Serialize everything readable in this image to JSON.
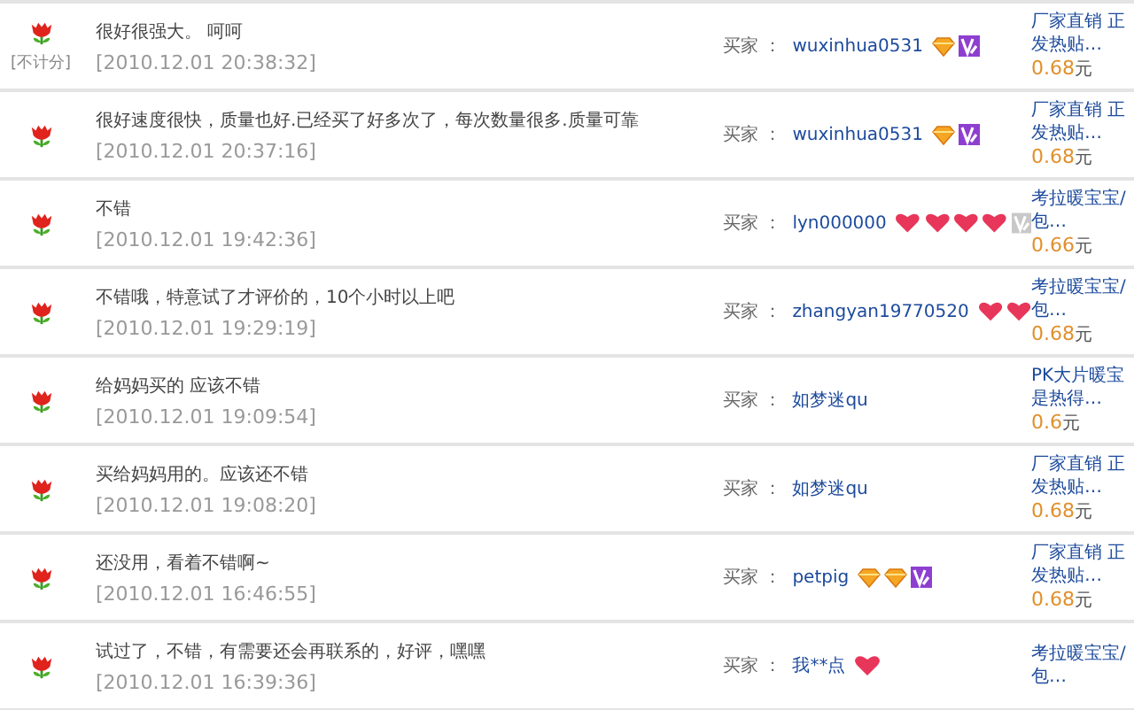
{
  "reviews": [
    {
      "rating": true,
      "note": "[不计分]",
      "comment": "很好很强大。 呵呵",
      "date": "[2010.12.01 20:38:32]",
      "buyer_label": "买家 ：",
      "buyer": "wuxinhua0531",
      "rank_icons": [
        {
          "kind": "diamond"
        }
      ],
      "vip_badge": {
        "active": true
      },
      "product": {
        "line1": "厂家直销 正",
        "line2": "发热贴…",
        "price": "0.68",
        "unit": "元"
      }
    },
    {
      "rating": true,
      "comment": "很好速度很快，质量也好.已经买了好多次了，每次数量很多.质量可靠",
      "date": "[2010.12.01 20:37:16]",
      "buyer_label": "买家 ：",
      "buyer": "wuxinhua0531",
      "rank_icons": [
        {
          "kind": "diamond"
        }
      ],
      "vip_badge": {
        "active": true
      },
      "product": {
        "line1": "厂家直销 正",
        "line2": "发热贴…",
        "price": "0.68",
        "unit": "元"
      }
    },
    {
      "rating": true,
      "comment": "不错",
      "date": "[2010.12.01 19:42:36]",
      "buyer_label": "买家 ：",
      "buyer": "lyn000000",
      "rank_icons": [
        {
          "kind": "heart"
        },
        {
          "kind": "heart"
        },
        {
          "kind": "heart"
        },
        {
          "kind": "heart"
        }
      ],
      "vip_badge": {
        "active": false
      },
      "product": {
        "line1": "考拉暖宝宝/",
        "line2": "包…",
        "price": "0.66",
        "unit": "元"
      }
    },
    {
      "rating": true,
      "comment": "不错哦，特意试了才评价的，10个小时以上吧",
      "date": "[2010.12.01 19:29:19]",
      "buyer_label": "买家 ：",
      "buyer": "zhangyan19770520",
      "rank_icons": [
        {
          "kind": "heart"
        },
        {
          "kind": "heart"
        }
      ],
      "product": {
        "line1": "考拉暖宝宝/",
        "line2": "包…",
        "price": "0.68",
        "unit": "元"
      }
    },
    {
      "rating": true,
      "comment": "给妈妈买的 应该不错",
      "date": "[2010.12.01 19:09:54]",
      "buyer_label": "买家 ：",
      "buyer": "如梦迷qu",
      "product": {
        "line1": "PK大片暖宝",
        "line2": "是热得…",
        "price": "0.6",
        "unit": "元"
      }
    },
    {
      "rating": true,
      "comment": "买给妈妈用的。应该还不错",
      "date": "[2010.12.01 19:08:20]",
      "buyer_label": "买家 ：",
      "buyer": "如梦迷qu",
      "product": {
        "line1": "厂家直销 正",
        "line2": "发热贴…",
        "price": "0.68",
        "unit": "元"
      }
    },
    {
      "rating": true,
      "comment": "还没用，看着不错啊~",
      "date": "[2010.12.01 16:46:55]",
      "buyer_label": "买家 ：",
      "buyer": "petpig",
      "rank_icons": [
        {
          "kind": "diamond"
        },
        {
          "kind": "diamond"
        }
      ],
      "vip_badge": {
        "active": true
      },
      "product": {
        "line1": "厂家直销 正",
        "line2": "发热贴…",
        "price": "0.68",
        "unit": "元"
      }
    },
    {
      "rating": true,
      "comment": "试过了，不错，有需要还会再联系的，好评，嘿嘿",
      "date": "[2010.12.01 16:39:36]",
      "buyer_label": "买家 ：",
      "buyer": "我**点",
      "rank_icons": [
        {
          "kind": "heart"
        }
      ],
      "product": {
        "line1": "考拉暖宝宝/",
        "line2": "包…"
      }
    }
  ]
}
